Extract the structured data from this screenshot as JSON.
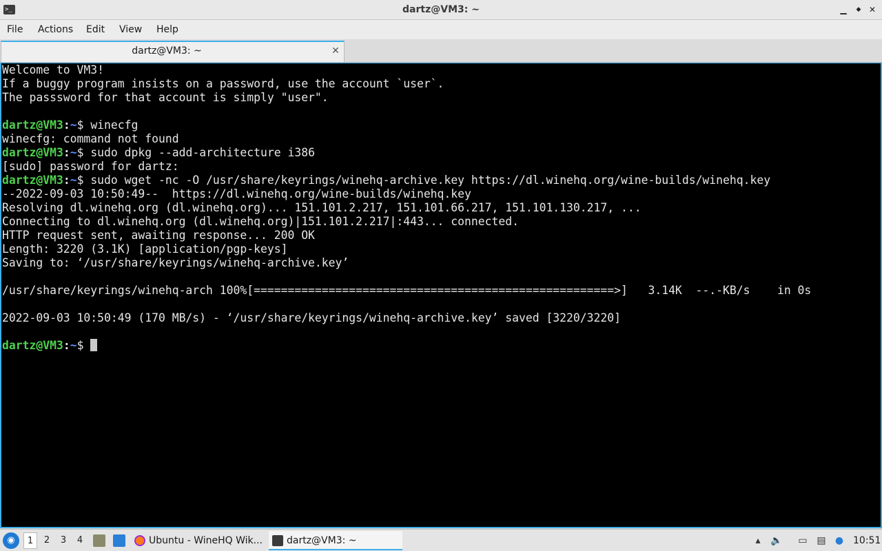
{
  "window": {
    "title": "dartz@VM3: ~",
    "minimize_glyph": "▁",
    "maximize_glyph": "◆",
    "close_glyph": "✕"
  },
  "menu": {
    "items": [
      "File",
      "Actions",
      "Edit",
      "View",
      "Help"
    ]
  },
  "tabs": [
    {
      "label": "dartz@VM3: ~",
      "close_glyph": "✕"
    }
  ],
  "terminal": {
    "prompt": {
      "user": "dartz@VM3",
      "sep": ":",
      "path": "~",
      "symbol": "$ "
    },
    "lines": [
      {
        "type": "out",
        "text": "Welcome to VM3!"
      },
      {
        "type": "out",
        "text": "If a buggy program insists on a password, use the account `user`."
      },
      {
        "type": "out",
        "text": "The passsword for that account is simply \"user\"."
      },
      {
        "type": "out",
        "text": ""
      },
      {
        "type": "cmd",
        "text": "winecfg"
      },
      {
        "type": "out",
        "text": "winecfg: command not found"
      },
      {
        "type": "cmd",
        "text": "sudo dpkg --add-architecture i386"
      },
      {
        "type": "out",
        "text": "[sudo] password for dartz:"
      },
      {
        "type": "cmd",
        "text": "sudo wget -nc -O /usr/share/keyrings/winehq-archive.key https://dl.winehq.org/wine-builds/winehq.key"
      },
      {
        "type": "out",
        "text": "--2022-09-03 10:50:49--  https://dl.winehq.org/wine-builds/winehq.key"
      },
      {
        "type": "out",
        "text": "Resolving dl.winehq.org (dl.winehq.org)... 151.101.2.217, 151.101.66.217, 151.101.130.217, ..."
      },
      {
        "type": "out",
        "text": "Connecting to dl.winehq.org (dl.winehq.org)|151.101.2.217|:443... connected."
      },
      {
        "type": "out",
        "text": "HTTP request sent, awaiting response... 200 OK"
      },
      {
        "type": "out",
        "text": "Length: 3220 (3.1K) [application/pgp-keys]"
      },
      {
        "type": "out",
        "text": "Saving to: ‘/usr/share/keyrings/winehq-archive.key’"
      },
      {
        "type": "out",
        "text": ""
      },
      {
        "type": "out",
        "text": "/usr/share/keyrings/winehq-arch 100%[=====================================================>]   3.14K  --.-KB/s    in 0s"
      },
      {
        "type": "out",
        "text": ""
      },
      {
        "type": "out",
        "text": "2022-09-03 10:50:49 (170 MB/s) - ‘/usr/share/keyrings/winehq-archive.key’ saved [3220/3220]"
      },
      {
        "type": "out",
        "text": ""
      },
      {
        "type": "cmd_cursor",
        "text": ""
      }
    ]
  },
  "taskbar": {
    "start_icon": "start-menu-icon",
    "workspaces": [
      "1",
      "2",
      "3",
      "4"
    ],
    "active_workspace": "1",
    "tasks": [
      {
        "label": "Ubuntu - WineHQ Wik...",
        "icon": "firefox-icon"
      },
      {
        "label": "dartz@VM3: ~",
        "icon": "terminal-icon"
      }
    ],
    "clock": "10:51"
  },
  "colors": {
    "accent": "#3daee9",
    "prompt_user": "#4fd04f",
    "prompt_path": "#5c8cff",
    "terminal_bg": "#000000",
    "terminal_fg": "#e6e6e6"
  }
}
